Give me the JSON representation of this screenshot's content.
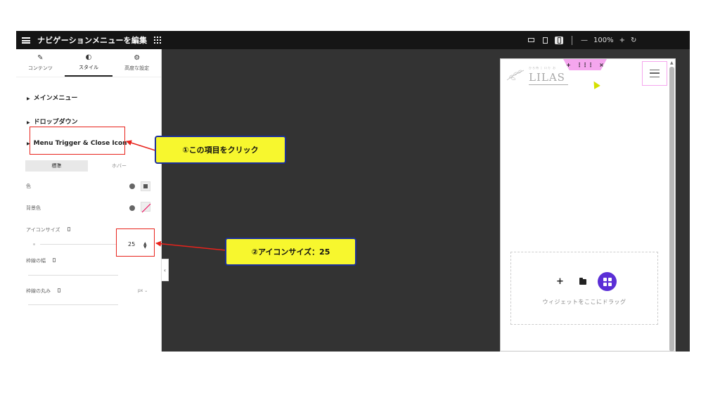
{
  "editor": {
    "panel_title": "ナビゲーションメニューを編集",
    "zoom": "100%"
  },
  "tabs": [
    {
      "label": "コンテンツ",
      "icon": "pencil-icon"
    },
    {
      "label": "スタイル",
      "icon": "half-circle-icon"
    },
    {
      "label": "高度な設定",
      "icon": "gear-icon"
    }
  ],
  "sections": {
    "main_menu": "メインメニュー",
    "dropdown": "ドロップダウン",
    "menu_trigger": "Menu Trigger & Close Icon"
  },
  "state_toggle": {
    "normal": "標準",
    "hover": "ホバー"
  },
  "controls": {
    "color_label": "色",
    "bg_color_label": "背景色",
    "icon_size_label": "アイコンサイズ",
    "icon_size_value": "25",
    "border_width_label": "枠線の幅",
    "border_radius_label": "枠線の丸み",
    "unit": "px"
  },
  "preview": {
    "logo_subtitle": "ひろ待 | ロカ お",
    "logo_text": "LILAS",
    "handle_plus": "+",
    "handle_drag": "⋮⋮⋮",
    "handle_close": "×",
    "drop_plus": "+",
    "drop_text": "ウィジェットをここにドラッグ"
  },
  "annotations": {
    "callout1": "①この項目をクリック",
    "callout2": "②アイコンサイズ：25"
  },
  "colors": {
    "accent_red": "#e8231c",
    "callout_bg": "#f7f72e",
    "callout_border": "#1c2f9a",
    "canvas_bg": "#333333",
    "handle_pink": "#f5a6ee",
    "ekit_purple": "#5b2fd6"
  }
}
